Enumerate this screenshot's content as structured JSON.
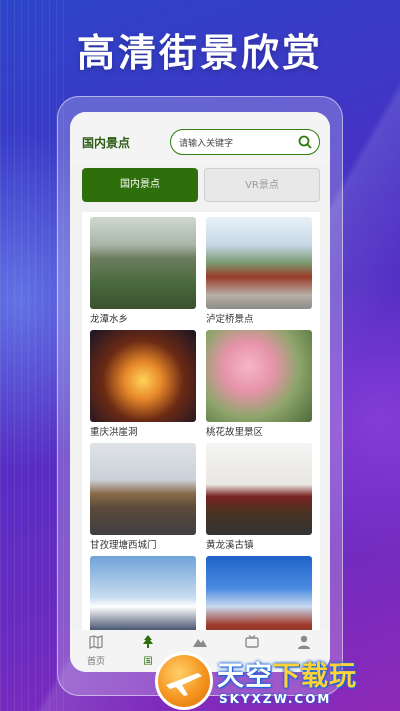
{
  "promo": {
    "headline": "高清街景欣赏"
  },
  "app": {
    "title": "国内景点",
    "search": {
      "placeholder": "请输入关键字"
    },
    "tabs": [
      {
        "label": "国内景点",
        "active": true
      },
      {
        "label": "VR景点",
        "active": false
      }
    ],
    "spots": [
      {
        "name": "龙潭水乡"
      },
      {
        "name": "泸定桥景点"
      },
      {
        "name": "重庆洪崖洞"
      },
      {
        "name": "桃花故里景区"
      },
      {
        "name": "甘孜理塘西城门"
      },
      {
        "name": "黄龙溪古镇"
      },
      {
        "name": ""
      },
      {
        "name": ""
      }
    ],
    "bottom_nav": [
      {
        "label": "首页",
        "icon": "map-icon",
        "active": false
      },
      {
        "label": "国",
        "icon": "tree-icon",
        "active": true
      },
      {
        "label": "",
        "icon": "mountain-icon",
        "active": false
      },
      {
        "label": "",
        "icon": "tv-icon",
        "active": false
      },
      {
        "label": "",
        "icon": "user-icon",
        "active": false
      }
    ],
    "colors": {
      "accent": "#2f6f0b",
      "inactive_tab": "#e8e8e8"
    }
  },
  "watermark": {
    "title_part1": "天空",
    "title_part2": "下载玩",
    "subtitle": "SKYXZW.COM"
  }
}
